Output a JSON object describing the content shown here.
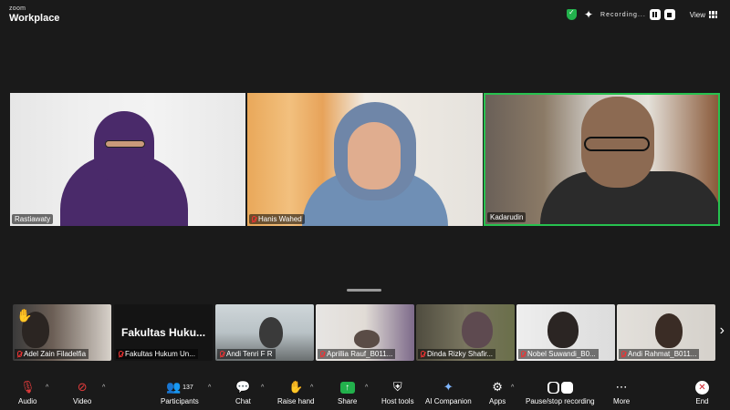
{
  "brand": {
    "line1": "zoom",
    "line2": "Workplace"
  },
  "topbar": {
    "recording_label": "Recording...",
    "view_label": "View"
  },
  "main_tiles": [
    {
      "name": "Rastiawaty",
      "muted": false
    },
    {
      "name": "Hanis Wahed",
      "muted": true
    },
    {
      "name": "Kadarudin",
      "muted": false,
      "active_speaker": true
    }
  ],
  "filmstrip": [
    {
      "name": "Adel Zain Filadelfia",
      "hand_raised": true
    },
    {
      "name": "Fakultas Hukum Un...",
      "video_title": "Fakultas  Huku..."
    },
    {
      "name": "Andi Tenri F R"
    },
    {
      "name": "Aprillia Rauf_B011..."
    },
    {
      "name": "Dinda Rizky Shafir..."
    },
    {
      "name": "Nobel Suwandi_B0..."
    },
    {
      "name": "Andi Rahmat_B011..."
    }
  ],
  "toolbar": {
    "audio": "Audio",
    "video": "Video",
    "participants": "Participants",
    "participants_count": "137",
    "chat": "Chat",
    "raise_hand": "Raise hand",
    "share": "Share",
    "host_tools": "Host tools",
    "ai_companion": "AI Companion",
    "apps": "Apps",
    "pause_stop": "Pause/stop recording",
    "more": "More",
    "end": "End"
  },
  "colors": {
    "accent_green": "#22b14c",
    "active_border": "#27c14f",
    "muted_red": "#e23b3b",
    "end_red": "#d0202a"
  }
}
